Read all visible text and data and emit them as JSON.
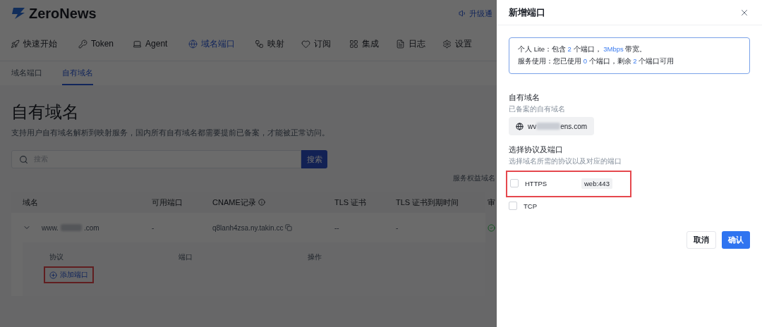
{
  "app": {
    "logo": "ZeroNews",
    "notice": "升级通"
  },
  "nav": [
    {
      "label": "快速开始",
      "selected": false
    },
    {
      "label": "Token",
      "selected": false
    },
    {
      "label": "Agent",
      "selected": false
    },
    {
      "label": "域名端口",
      "selected": true
    },
    {
      "label": "映射",
      "selected": false
    },
    {
      "label": "订阅",
      "selected": false
    },
    {
      "label": "集成",
      "selected": false
    },
    {
      "label": "日志",
      "selected": false
    },
    {
      "label": "设置",
      "selected": false
    }
  ],
  "subtabs": [
    {
      "label": "域名端口",
      "selected": false
    },
    {
      "label": "自有域名",
      "selected": true
    }
  ],
  "page": {
    "title": "自有域名",
    "description": "支持用户自有域名解析到映射服务，国内所有自有域名都需要提前已备案，才能被正常访问。"
  },
  "search": {
    "placeholder": "搜索",
    "button": "搜索"
  },
  "quota_note": "服务权益域名",
  "table": {
    "columns": [
      "域名",
      "可用端口",
      "CNAME记录",
      "TLS 证书",
      "TLS 证书到期时间",
      "审"
    ],
    "rows": [
      {
        "expanded": true,
        "domain_prefix": "www.",
        "domain_suffix": ".com",
        "ports": "-",
        "cname": "q8lanh4zsa.ny.takin.cc",
        "tls": "--",
        "tls_expiry": "-",
        "detail": {
          "columns": [
            "协议",
            "端口",
            "操作"
          ],
          "add_button": "添加端口"
        }
      }
    ]
  },
  "drawer": {
    "title": "新增端口",
    "info": {
      "line1": "个人 Lite：包含 **2** 个端口， **3Mbps** 带宽。",
      "line2": "服务使用：您已使用 **0** 个端口，剩余 **2** 个端口可用"
    },
    "domain_label": "自有域名",
    "domain_hint": "已备案的自有域名",
    "domain_prefix": "wv",
    "domain_suffix": "ens.com",
    "protocol_label": "选择协议及端口",
    "protocol_hint": "选择域名所需的协议以及对应的端口",
    "protocols": [
      {
        "name": "HTTPS",
        "checked": false,
        "port": "web:443"
      },
      {
        "name": "TCP",
        "checked": false
      }
    ],
    "cancel": "取消",
    "confirm": "确认"
  }
}
